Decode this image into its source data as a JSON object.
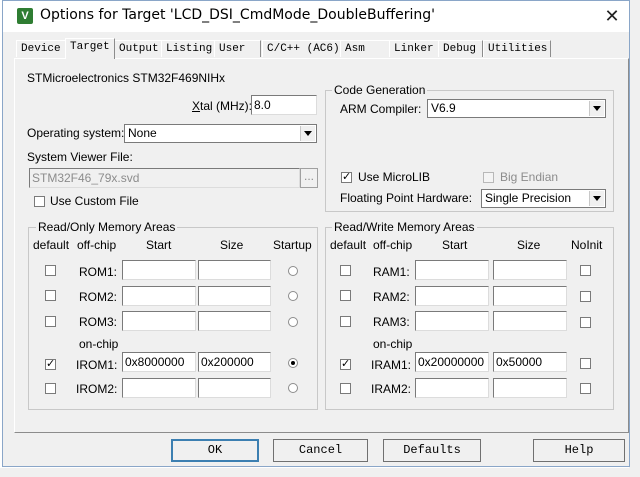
{
  "window": {
    "title": "Options for Target 'LCD_DSI_CmdMode_DoubleBuffering'",
    "app_icon": "uvision-icon",
    "app_icon_glyph": "V",
    "close_glyph": "✕"
  },
  "tabs": [
    {
      "label": "Device"
    },
    {
      "label": "Target",
      "active": true
    },
    {
      "label": "Output"
    },
    {
      "label": "Listing"
    },
    {
      "label": "User"
    },
    {
      "label": "C/C++ (AC6)"
    },
    {
      "label": "Asm"
    },
    {
      "label": "Linker"
    },
    {
      "label": "Debug"
    },
    {
      "label": "Utilities"
    }
  ],
  "device_name": "STMicroelectronics STM32F469NIHx",
  "xtal": {
    "label_prefix": "X",
    "label_rest": "tal (MHz):",
    "value": "8.0"
  },
  "os": {
    "label": "Operating system:",
    "value": "None"
  },
  "svd": {
    "label": "System Viewer File:",
    "value": "STM32F46_79x.svd",
    "browse": "..."
  },
  "custom_file": {
    "label": "Use Custom File",
    "checked": false
  },
  "codegen": {
    "group_title": "Code Generation",
    "compiler_label": "ARM Compiler:",
    "compiler_value": "V6.9",
    "microlib_label": "Use MicroLIB",
    "microlib_checked": true,
    "big_endian_label": "Big Endian",
    "big_endian_checked": false,
    "fpu_label": "Floating Point Hardware:",
    "fpu_value": "Single Precision"
  },
  "rom": {
    "group_title": "Read/Only Memory Areas",
    "headers": {
      "default": "default",
      "offchip": "off-chip",
      "start": "Start",
      "size": "Size",
      "startup": "Startup"
    },
    "onchip_label": "on-chip",
    "rows": [
      {
        "label": "ROM1:",
        "default": false,
        "start": "",
        "size": "",
        "startup": false
      },
      {
        "label": "ROM2:",
        "default": false,
        "start": "",
        "size": "",
        "startup": false
      },
      {
        "label": "ROM3:",
        "default": false,
        "start": "",
        "size": "",
        "startup": false
      },
      {
        "label": "IROM1:",
        "default": true,
        "start": "0x8000000",
        "size": "0x200000",
        "startup": true
      },
      {
        "label": "IROM2:",
        "default": false,
        "start": "",
        "size": "",
        "startup": false
      }
    ]
  },
  "ram": {
    "group_title": "Read/Write Memory Areas",
    "headers": {
      "default": "default",
      "offchip": "off-chip",
      "start": "Start",
      "size": "Size",
      "noinit": "NoInit"
    },
    "onchip_label": "on-chip",
    "rows": [
      {
        "label": "RAM1:",
        "default": false,
        "start": "",
        "size": "",
        "noinit": false
      },
      {
        "label": "RAM2:",
        "default": false,
        "start": "",
        "size": "",
        "noinit": false
      },
      {
        "label": "RAM3:",
        "default": false,
        "start": "",
        "size": "",
        "noinit": false
      },
      {
        "label": "IRAM1:",
        "default": true,
        "start": "0x20000000",
        "size": "0x50000",
        "noinit": false
      },
      {
        "label": "IRAM2:",
        "default": false,
        "start": "",
        "size": "",
        "noinit": false
      }
    ]
  },
  "buttons": {
    "ok": "OK",
    "cancel": "Cancel",
    "defaults": "Defaults",
    "help": "Help"
  },
  "colors": {
    "dialog_bg": "#f0f0f0",
    "default_button_border": "#3c7fb1",
    "app_icon_bg": "#2f7d32"
  }
}
